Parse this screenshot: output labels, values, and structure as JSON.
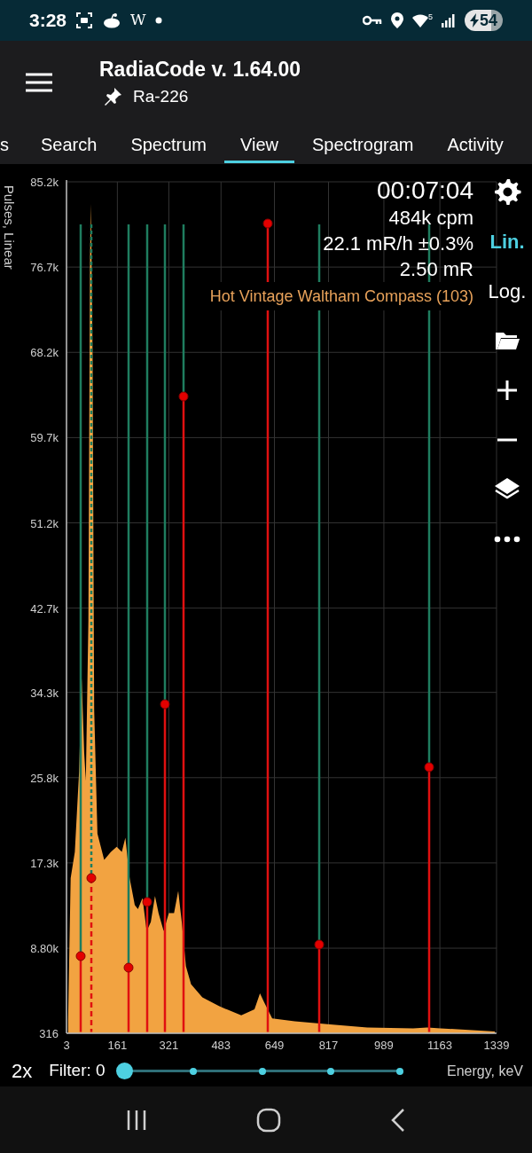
{
  "status_bar": {
    "time": "3:28",
    "app_letter": "W",
    "wifi_badge": "5",
    "battery": "54",
    "charging": true
  },
  "app_bar": {
    "title": "RadiaCode v. 1.64.00",
    "subtitle": "Ra-226"
  },
  "tabs": [
    {
      "label": "s",
      "selected": false
    },
    {
      "label": "Search",
      "selected": false
    },
    {
      "label": "Spectrum",
      "selected": false
    },
    {
      "label": "View",
      "selected": true
    },
    {
      "label": "Spectrogram",
      "selected": false
    },
    {
      "label": "Activity",
      "selected": false
    }
  ],
  "chart": {
    "stats": [
      {
        "text": "00:07:04",
        "kind": "large"
      },
      {
        "text": "484k cpm",
        "kind": "normal"
      },
      {
        "text": "22.1 mR/h ±0.3%",
        "kind": "normal"
      },
      {
        "text": "2.50 mR",
        "kind": "normal"
      },
      {
        "text": "Hot Vintage Waltham Compass (103)",
        "kind": "source"
      }
    ],
    "chart_data": {
      "type": "area",
      "xlabel": "Energy, keV",
      "ylabel": "Pulses, Linear",
      "x": [
        8,
        16,
        29,
        42,
        50,
        58,
        63,
        71,
        76,
        79,
        84,
        89,
        99,
        120,
        141,
        159,
        175,
        186,
        199,
        215,
        225,
        239,
        252,
        265,
        278,
        289,
        305,
        321,
        337,
        350,
        361,
        374,
        390,
        425,
        478,
        546,
        587,
        604,
        617,
        642,
        712,
        822,
        937,
        1080,
        1124,
        1165,
        1334
      ],
      "series": [
        {
          "color": "#f2a341",
          "values": [
            1600,
            15800,
            18400,
            26400,
            35700,
            28200,
            25500,
            41400,
            77700,
            83000,
            68000,
            32600,
            20200,
            17600,
            18400,
            18900,
            18400,
            19800,
            15800,
            13100,
            12700,
            13800,
            10500,
            11400,
            14000,
            12300,
            10500,
            12300,
            12300,
            14500,
            11400,
            7000,
            5200,
            3900,
            3000,
            2100,
            2700,
            4300,
            3400,
            1800,
            1500,
            1200,
            900,
            800,
            900,
            800,
            500
          ]
        }
      ],
      "grid": true,
      "xlim": [
        3,
        1339
      ],
      "xticks": [
        3,
        161,
        321,
        483,
        649,
        817,
        989,
        1163,
        1339
      ],
      "yticks": [
        {
          "value": 316,
          "label": "316"
        },
        {
          "value": 8800,
          "label": "8.80k"
        },
        {
          "value": 17300,
          "label": "17.3k"
        },
        {
          "value": 25800,
          "label": "25.8k"
        },
        {
          "value": 34300,
          "label": "34.3k"
        },
        {
          "value": 42700,
          "label": "42.7k"
        },
        {
          "value": 51200,
          "label": "51.2k"
        },
        {
          "value": 59700,
          "label": "59.7k"
        },
        {
          "value": 68200,
          "label": "68.2k"
        },
        {
          "value": 76700,
          "label": "76.7k"
        },
        {
          "value": 85200,
          "label": "85.2k"
        }
      ],
      "ylim": [
        316,
        85200
      ]
    }
  },
  "toolbar": [
    {
      "kind": "settings"
    },
    {
      "kind": "text",
      "label": "Lin.",
      "selected": true
    },
    {
      "kind": "text",
      "label": "Log.",
      "selected": false
    },
    {
      "kind": "open"
    },
    {
      "kind": "zoom_in"
    },
    {
      "kind": "zoom_out"
    },
    {
      "kind": "layers"
    },
    {
      "kind": "more"
    }
  ],
  "controls": {
    "zoom": "2x",
    "filter_label": "Filter: 0",
    "filter": {
      "level": 0
    }
  }
}
